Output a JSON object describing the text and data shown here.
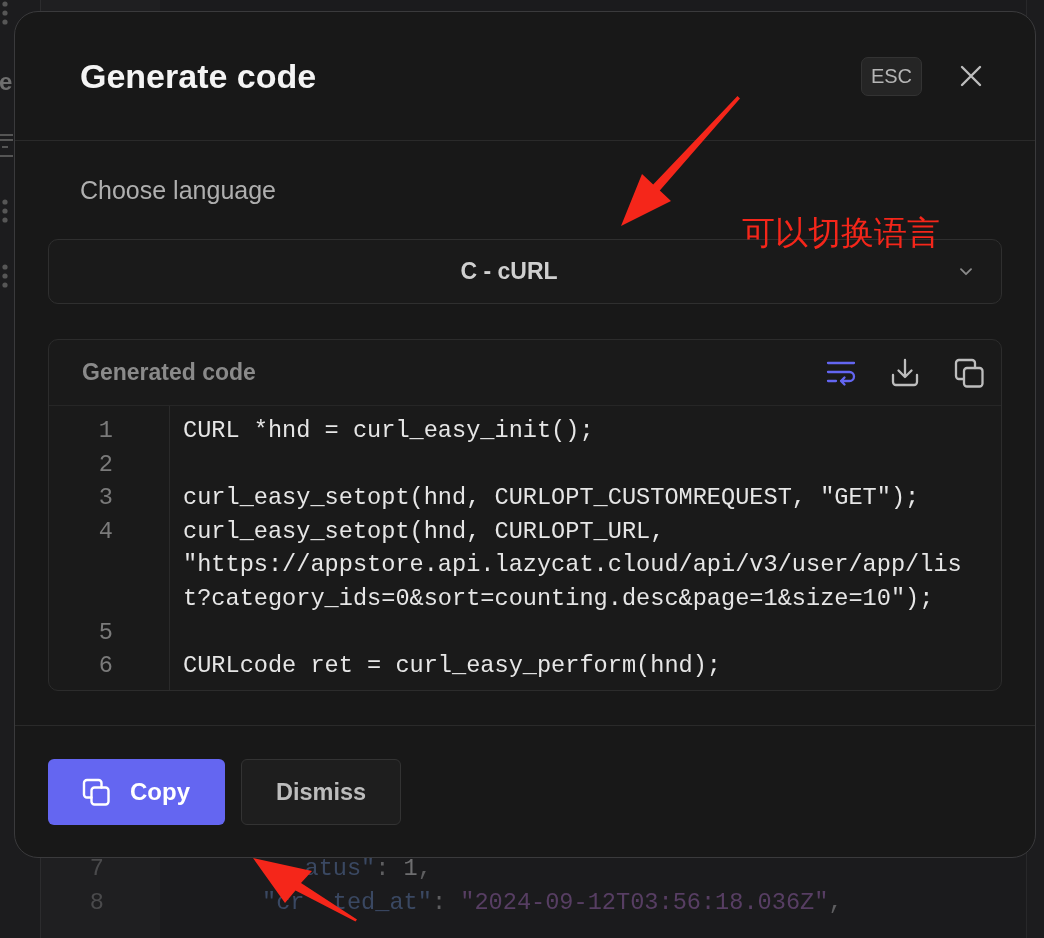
{
  "background": {
    "page_text": "e",
    "code_lines": [
      {
        "number": "7",
        "runs": [
          {
            "segments": [
              {
                "kind": "key",
                "text": "atus\""
              },
              {
                "kind": "punct",
                "text": ": "
              },
              {
                "kind": "number",
                "text": "1"
              },
              {
                "kind": "punct",
                "text": ","
              }
            ]
          }
        ]
      },
      {
        "number": "8",
        "runs": [
          {
            "segments": [
              {
                "kind": "key",
                "text": "\"cr"
              }
            ]
          },
          {
            "segments": [
              {
                "kind": "key",
                "text": "ted_at\""
              },
              {
                "kind": "punct",
                "text": ": "
              },
              {
                "kind": "string",
                "text": "\"2024-09-12T03:56:18.036Z\""
              },
              {
                "kind": "punct",
                "text": ","
              }
            ]
          }
        ]
      }
    ]
  },
  "dialog": {
    "title": "Generate code",
    "esc_hint": "ESC",
    "language_label": "Choose language",
    "language_select": {
      "value": "C - cURL"
    },
    "code_panel": {
      "title": "Generated code",
      "wrap_lines": true,
      "lines": [
        {
          "number": "1",
          "rows": [
            "CURL *hnd = curl_easy_init();"
          ]
        },
        {
          "number": "2"
        },
        {
          "number": "3",
          "rows": [
            "curl_easy_setopt(hnd, CURLOPT_CUSTOMREQUEST, \"GET\");"
          ]
        },
        {
          "number": "4",
          "rows": [
            "curl_easy_setopt(hnd, CURLOPT_URL,",
            "\"https://appstore.api.lazycat.cloud/api/v3/user/app/lis",
            "t?category_ids=0&sort=counting.desc&page=1&size=10\");"
          ]
        },
        {
          "number": "5"
        },
        {
          "number": "6",
          "rows": [
            "CURLcode ret = curl_easy_perform(hnd);"
          ]
        }
      ]
    },
    "buttons": [
      {
        "label": "Copy",
        "kind": "primary"
      },
      {
        "label": "Dismiss",
        "kind": "secondary"
      }
    ]
  },
  "annotation": {
    "text": "可以切换语言"
  }
}
